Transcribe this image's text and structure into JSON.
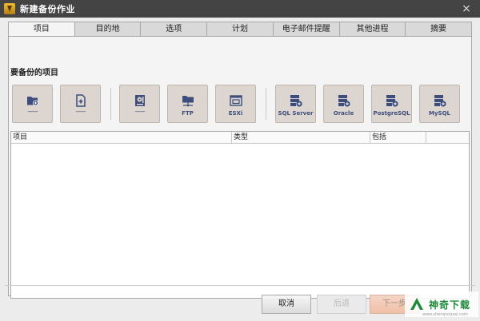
{
  "window": {
    "title": "新建备份作业",
    "close_glyph": "×"
  },
  "tabs": [
    {
      "label": "项目",
      "active": true
    },
    {
      "label": "目的地"
    },
    {
      "label": "选项"
    },
    {
      "label": "计划"
    },
    {
      "label": "电子邮件提醒"
    },
    {
      "label": "其他进程"
    },
    {
      "label": "摘要"
    }
  ],
  "section": {
    "label": "要备份的项目"
  },
  "source_buttons": [
    {
      "icon": "folder-add-icon",
      "label": "--------"
    },
    {
      "icon": "file-add-icon",
      "label": "--------"
    },
    {
      "icon": "disk-icon",
      "label": "--------"
    },
    {
      "icon": "ftp-folder-icon",
      "label": "FTP"
    },
    {
      "icon": "esxi-window-icon",
      "label": "ESXi"
    },
    {
      "icon": "database-add-icon",
      "label": "SQL Server"
    },
    {
      "icon": "database-add-icon",
      "label": "Oracle"
    },
    {
      "icon": "database-add-icon",
      "label": "PostgreSQL"
    },
    {
      "icon": "database-add-icon",
      "label": "MySQL"
    }
  ],
  "list": {
    "columns": [
      "项目",
      "类型",
      "包括",
      ""
    ]
  },
  "footer": {
    "cancel_label": "取消",
    "back_label": "后退",
    "next_label": "下一步"
  },
  "watermark": {
    "text": "神奇下载",
    "sub": "www.shenqixiazai.com"
  },
  "colors": {
    "titlebar": "#444444",
    "icon_blue": "#3d4d7c",
    "button_bg": "#ddd6d0",
    "watermark_green": "#1d8a3a"
  }
}
